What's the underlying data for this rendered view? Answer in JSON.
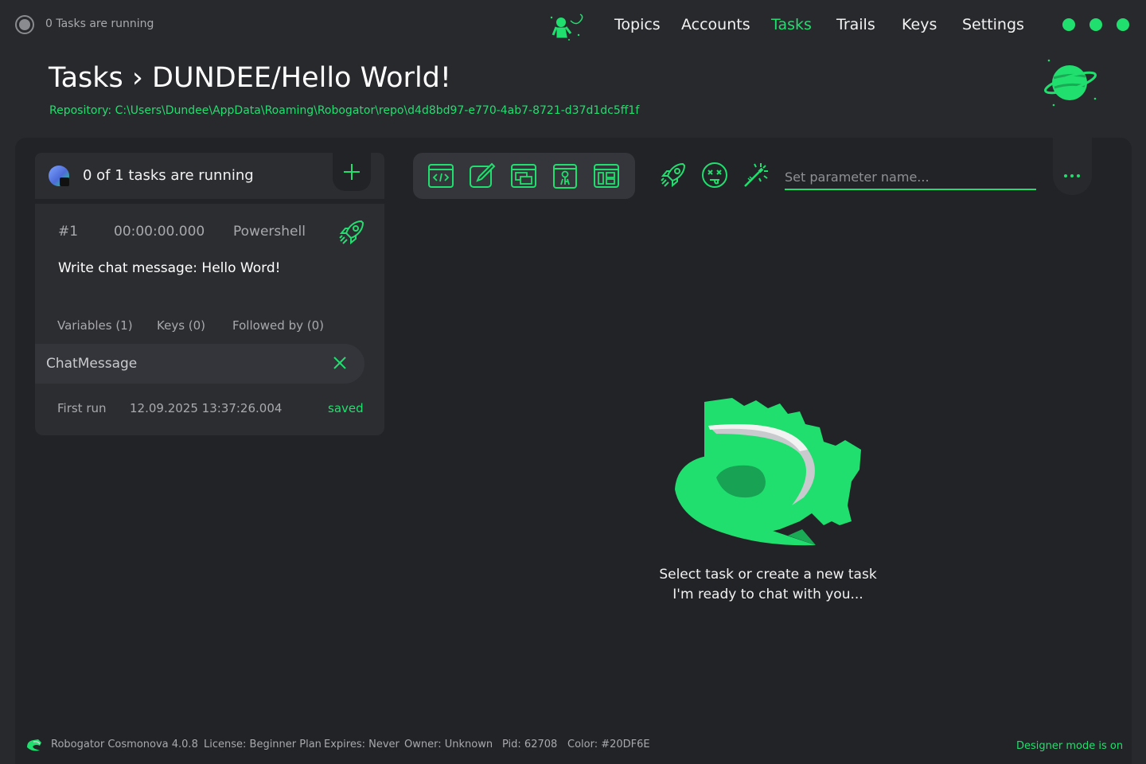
{
  "top_status": {
    "text": "0 Tasks are running"
  },
  "nav": {
    "topics": "Topics",
    "accounts": "Accounts",
    "tasks": "Tasks",
    "trails": "Trails",
    "keys": "Keys",
    "settings": "Settings"
  },
  "header": {
    "title": "Tasks › DUNDEE/Hello World!",
    "repository": "Repository: C:\\Users\\Dundee\\AppData\\Roaming\\Robogator\\repo\\d4d8bd97-e770-4ab7-8721-d37d1dc5ff1f"
  },
  "task_list": {
    "header": "0 of 1 tasks are running",
    "task": {
      "number": "#1",
      "duration": "00:00:00.000",
      "type": "Powershell",
      "message": "Write chat message: Hello Word!",
      "tabs": {
        "variables": "Variables (1)",
        "keys": "Keys (0)",
        "followed_by": "Followed by (0)"
      },
      "variable_name": "ChatMessage",
      "first_run_label": "First run",
      "first_run_date": "12.09.2025 13:37:26.004",
      "saved": "saved"
    }
  },
  "parameter": {
    "placeholder": "Set parameter name..."
  },
  "empty_state": {
    "line1": "Select task or create a new task",
    "line2": "I'm ready to chat with you..."
  },
  "footer": {
    "product": "Robogator Cosmonova 4.0.8",
    "license": "License: Beginner Plan",
    "expires": "Expires: Never",
    "owner": "Owner: Unknown",
    "pid": "Pid: 62708",
    "color": "Color: #20DF6E",
    "designer_mode": "Designer mode is on"
  },
  "colors": {
    "accent": "#20DF6E",
    "background": "#28292d",
    "panel": "#222326",
    "card": "#2c2d31"
  },
  "icons": [
    "astronaut-icon",
    "planet-icon",
    "add-icon",
    "rocket-icon",
    "close-icon",
    "code-window-icon",
    "edit-icon",
    "windows-icon",
    "key-window-icon",
    "layout-window-icon",
    "dizzy-face-icon",
    "magic-wand-icon",
    "more-icon",
    "robogator-logo"
  ]
}
